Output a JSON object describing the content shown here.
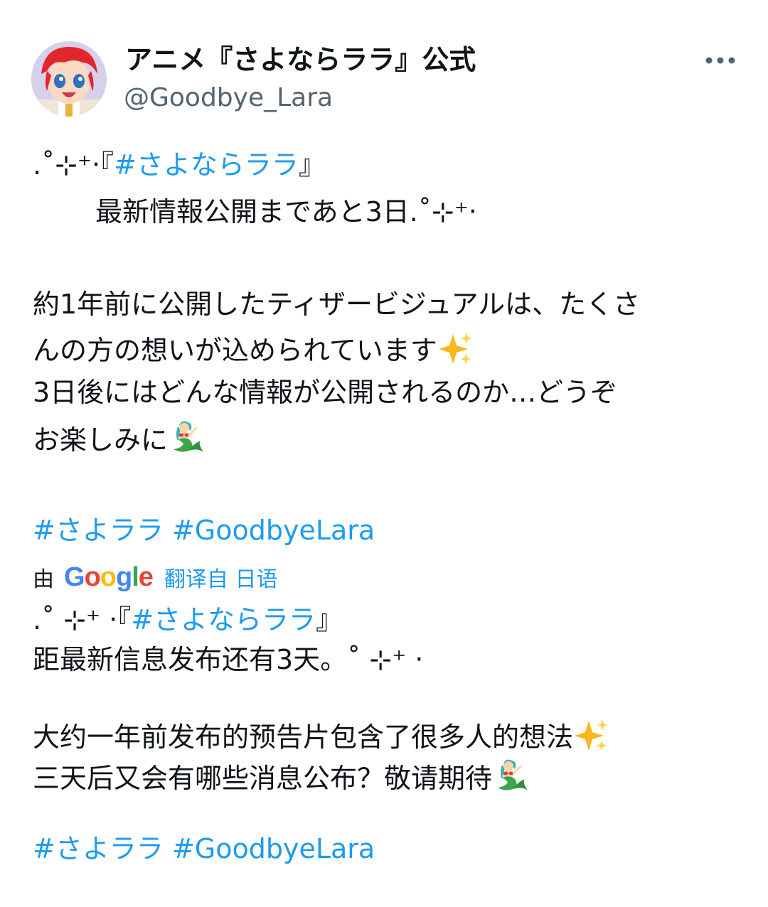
{
  "author": {
    "display_name": "アニメ『さよならララ』公式",
    "handle": "@Goodbye_Lara",
    "avatar_icon": "anime-character-avatar"
  },
  "more_icon": "more-horizontal-icon",
  "original": {
    "line1_prefix": ".˚⊹⁺‧『",
    "line1_tag": "#さよならララ",
    "line1_suffix": "』",
    "line2": "最新情報公開まであと3日.˚⊹⁺‧",
    "line3": "約1年前に公開したティザービジュアルは、たくさ",
    "line4": "んの方の想いが込められています",
    "line5": "3日後にはどんな情報が公開されるのか…どうぞ",
    "line6": "お楽しみに",
    "tag1": "#さよララ",
    "tag2": "#GoodbyeLara"
  },
  "translation_bar": {
    "by_label": "由",
    "google_logo": "Google",
    "translated_from": "翻译自 日语"
  },
  "translated": {
    "line1_prefix": ".˚ ⊹⁺ ‧『",
    "line1_tag": "#さよならララ",
    "line1_suffix": "』",
    "line2": "距最新信息发布还有3天。˚ ⊹⁺ ‧",
    "line3": "大约一年前发布的预告片包含了很多人的想法",
    "line4": "三天后又会有哪些消息公布？敬请期待",
    "tag1": "#さよララ",
    "tag2": "#GoodbyeLara"
  },
  "colors": {
    "link": "#1d9bf0",
    "handle": "#536471",
    "text": "#0f1419"
  },
  "emojis": [
    "sparkles-icon",
    "mermaid-icon"
  ]
}
